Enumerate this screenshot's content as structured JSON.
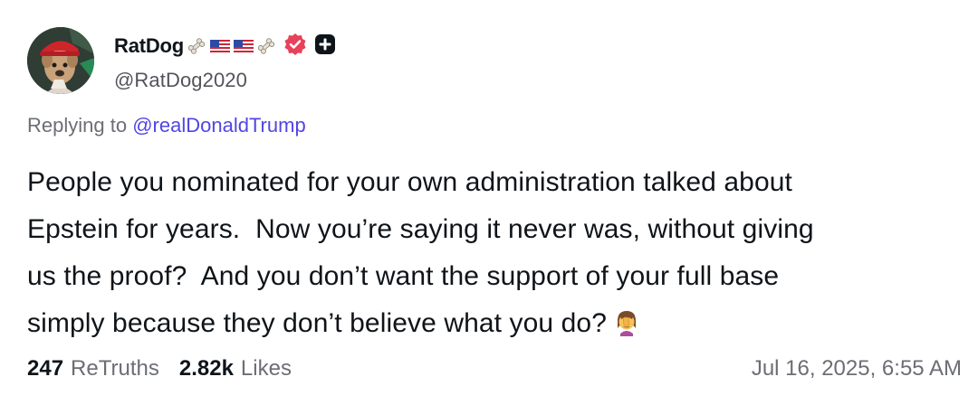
{
  "post": {
    "author": {
      "display_name": "RatDog",
      "handle": "@RatDog2020",
      "name_emojis": [
        "bone-icon",
        "us-flag-icon",
        "us-flag-icon",
        "bone-icon"
      ],
      "verified_badge": "verified-badge-icon",
      "plus_badge": "plus-badge-icon"
    },
    "reply": {
      "prefix": "Replying to",
      "mention": "@realDonaldTrump"
    },
    "body_lines": [
      "People you nominated for your own administration talked about",
      "Epstein for years.  Now you’re saying it never was, without giving",
      "us the proof?  And you don’t want the support of your full base",
      "simply because they don’t believe what you do?"
    ],
    "body_emoji": "facepalm-emoji",
    "stats": {
      "retruths_count": "247",
      "retruths_label": "ReTruths",
      "likes_count": "2.82k",
      "likes_label": "Likes"
    },
    "timestamp": "Jul 16, 2025, 6:55 AM"
  },
  "colors": {
    "text_primary": "#0f1419",
    "text_secondary": "#6b6e74",
    "mention": "#5046e4",
    "verified_badge": "#e8415a",
    "plus_badge": "#0f1419"
  }
}
